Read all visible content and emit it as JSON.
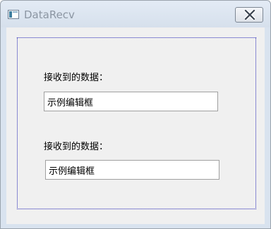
{
  "window": {
    "title": "DataRecv",
    "app_icon": "window-icon",
    "close_icon": "close-icon"
  },
  "form": {
    "rows": [
      {
        "label": "接收到的数据：",
        "value": "示例编辑框"
      },
      {
        "label": "接收到的数据：",
        "value": "示例编辑框"
      }
    ]
  },
  "colors": {
    "client_background": "#f0f0f0",
    "frame_dotted_border": "#2323b4",
    "title_text": "#8c96a3"
  }
}
